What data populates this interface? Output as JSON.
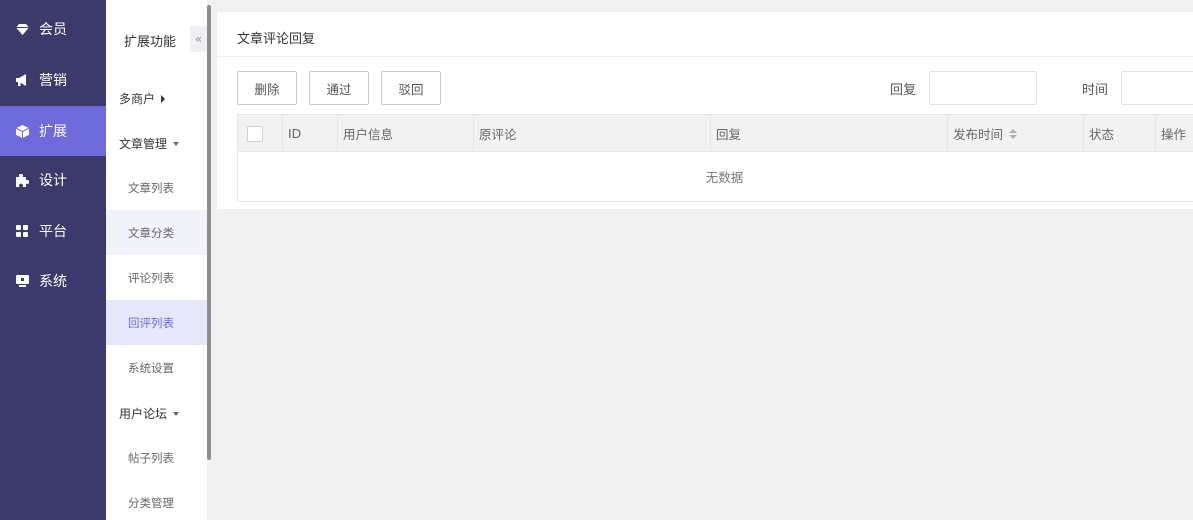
{
  "sidebar": {
    "items": [
      {
        "label": "会员",
        "icon": "gem-icon"
      },
      {
        "label": "营销",
        "icon": "megaphone-icon"
      },
      {
        "label": "扩展",
        "icon": "cube-icon",
        "active": true
      },
      {
        "label": "设计",
        "icon": "puzzle-icon"
      },
      {
        "label": "平台",
        "icon": "grid-icon"
      },
      {
        "label": "系统",
        "icon": "monitor-icon"
      }
    ]
  },
  "subnav": {
    "title": "扩展功能",
    "collapse": "«",
    "groups": [
      {
        "label": "多商户"
      },
      {
        "label": "文章管理"
      },
      {
        "label": "用户论坛"
      }
    ],
    "items": [
      {
        "label": "文章列表"
      },
      {
        "label": "文章分类"
      },
      {
        "label": "评论列表"
      },
      {
        "label": "回评列表"
      },
      {
        "label": "系统设置"
      },
      {
        "label": "帖子列表"
      },
      {
        "label": "分类管理"
      }
    ]
  },
  "main": {
    "title": "文章评论回复",
    "buttons": {
      "delete": "删除",
      "approve": "通过",
      "reject": "驳回"
    },
    "search": {
      "reply_label": "回复",
      "time_label": "时间"
    },
    "table": {
      "columns": [
        "ID",
        "用户信息",
        "原评论",
        "回复",
        "发布时间",
        "状态",
        "操作"
      ],
      "empty_text": "无数据"
    }
  },
  "colors": {
    "sidebar_bg": "#3b3a6b",
    "accent": "#6f6ad9"
  }
}
